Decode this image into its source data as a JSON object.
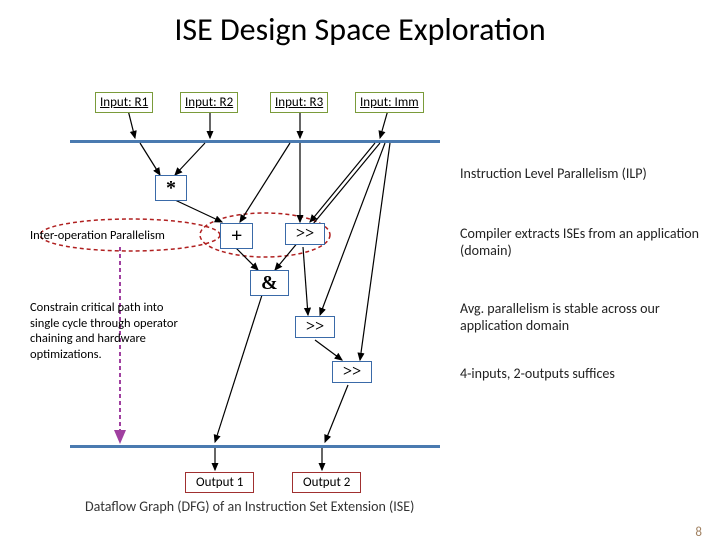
{
  "title": "ISE Design Space Exploration",
  "inputs": {
    "r1": "Input: R1",
    "r2": "Input: R2",
    "r3": "Input: R3",
    "imm": "Input: Imm"
  },
  "ops": {
    "mul": "*",
    "add": "+",
    "shr1": ">>",
    "and": "&",
    "shr2": ">>",
    "shr3": ">>"
  },
  "outputs": {
    "o1": "Output 1",
    "o2": "Output 2"
  },
  "labels": {
    "interop": "Inter-operation Parallelism",
    "constrain": "Constrain critical path into single cycle through operator chaining and hardware optimizations."
  },
  "bullets": {
    "ilp": "Instruction Level Parallelism (ILP)",
    "compiler": "Compiler extracts ISEs from an application (domain)",
    "avg": "Avg. parallelism is stable across our application domain",
    "suffices": "4-inputs, 2-outputs suffices"
  },
  "caption": "Dataflow Graph (DFG) of an Instruction Set Extension (ISE)",
  "pagenum": "8"
}
